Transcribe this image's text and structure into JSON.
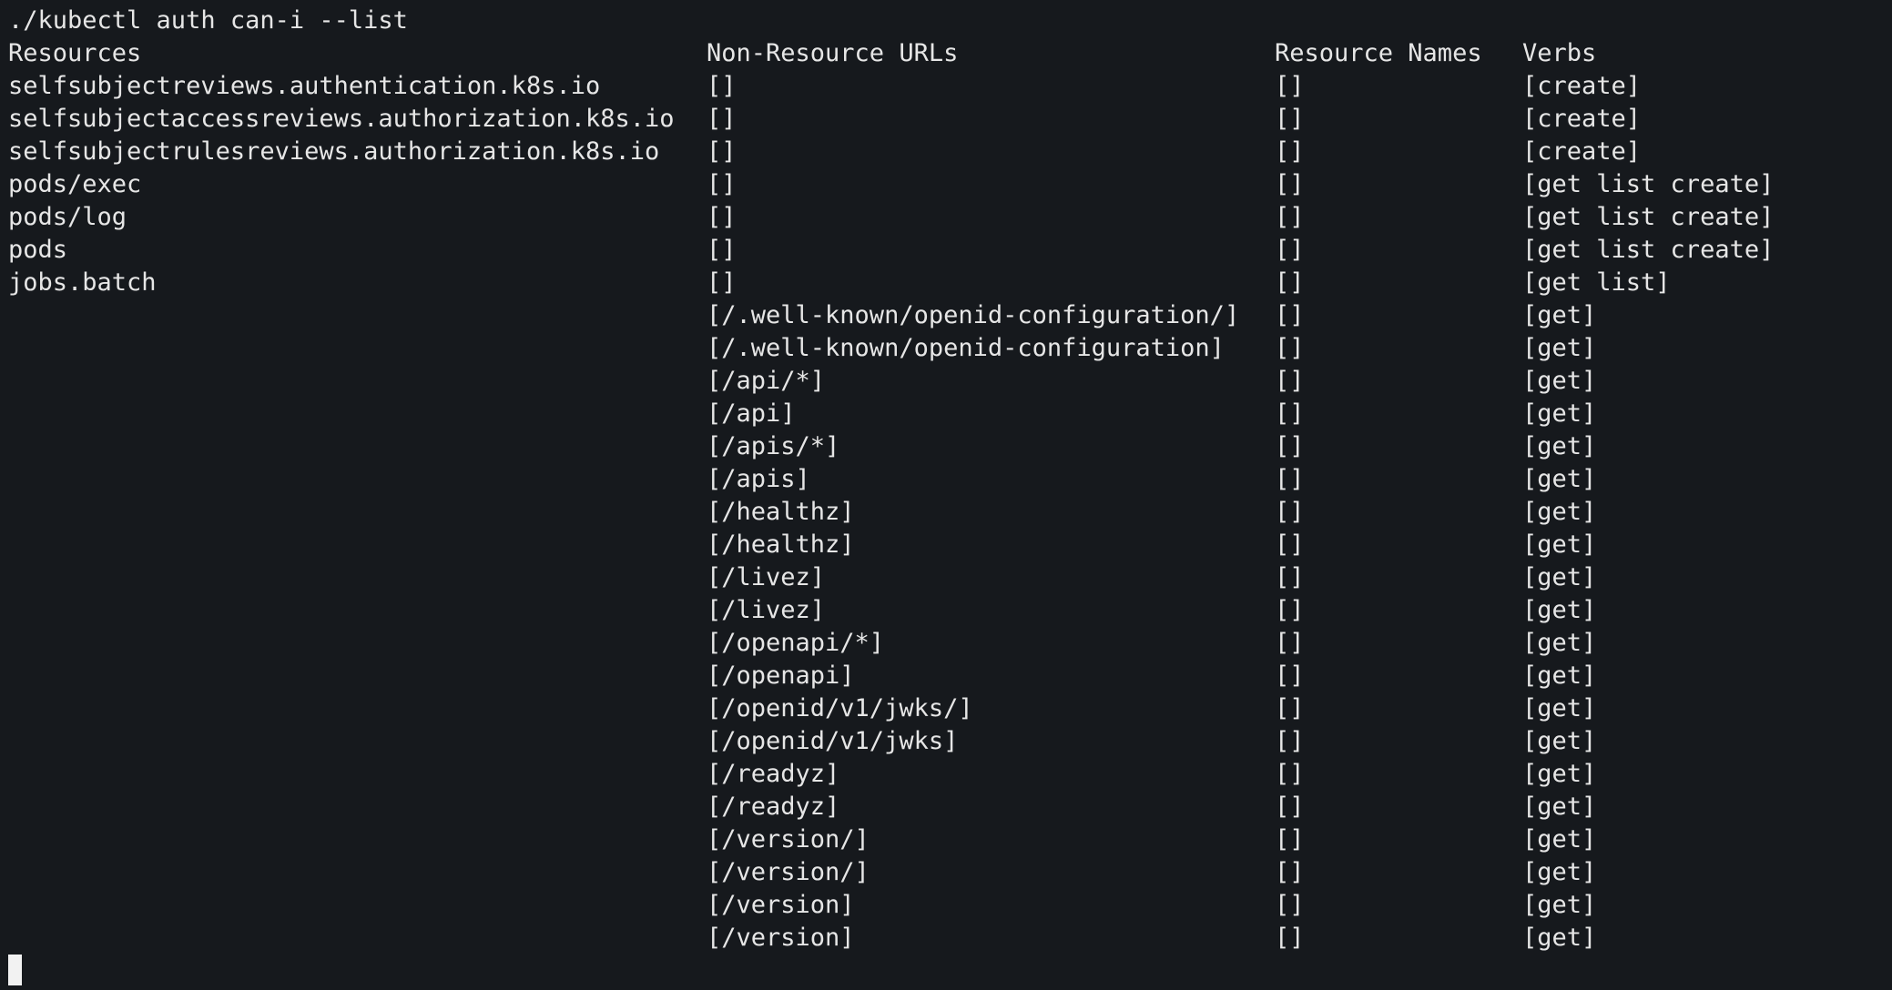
{
  "command": "./kubectl auth can-i --list",
  "headers": {
    "resources": "Resources",
    "non_resource_urls": "Non-Resource URLs",
    "resource_names": "Resource Names",
    "verbs": "Verbs"
  },
  "rows": [
    {
      "resource": "selfsubjectreviews.authentication.k8s.io",
      "url": "[]",
      "names": "[]",
      "verbs": "[create]"
    },
    {
      "resource": "selfsubjectaccessreviews.authorization.k8s.io",
      "url": "[]",
      "names": "[]",
      "verbs": "[create]"
    },
    {
      "resource": "selfsubjectrulesreviews.authorization.k8s.io",
      "url": "[]",
      "names": "[]",
      "verbs": "[create]"
    },
    {
      "resource": "pods/exec",
      "url": "[]",
      "names": "[]",
      "verbs": "[get list create]"
    },
    {
      "resource": "pods/log",
      "url": "[]",
      "names": "[]",
      "verbs": "[get list create]"
    },
    {
      "resource": "pods",
      "url": "[]",
      "names": "[]",
      "verbs": "[get list create]"
    },
    {
      "resource": "jobs.batch",
      "url": "[]",
      "names": "[]",
      "verbs": "[get list]"
    },
    {
      "resource": "",
      "url": "[/.well-known/openid-configuration/]",
      "names": "[]",
      "verbs": "[get]"
    },
    {
      "resource": "",
      "url": "[/.well-known/openid-configuration]",
      "names": "[]",
      "verbs": "[get]"
    },
    {
      "resource": "",
      "url": "[/api/*]",
      "names": "[]",
      "verbs": "[get]"
    },
    {
      "resource": "",
      "url": "[/api]",
      "names": "[]",
      "verbs": "[get]"
    },
    {
      "resource": "",
      "url": "[/apis/*]",
      "names": "[]",
      "verbs": "[get]"
    },
    {
      "resource": "",
      "url": "[/apis]",
      "names": "[]",
      "verbs": "[get]"
    },
    {
      "resource": "",
      "url": "[/healthz]",
      "names": "[]",
      "verbs": "[get]"
    },
    {
      "resource": "",
      "url": "[/healthz]",
      "names": "[]",
      "verbs": "[get]"
    },
    {
      "resource": "",
      "url": "[/livez]",
      "names": "[]",
      "verbs": "[get]"
    },
    {
      "resource": "",
      "url": "[/livez]",
      "names": "[]",
      "verbs": "[get]"
    },
    {
      "resource": "",
      "url": "[/openapi/*]",
      "names": "[]",
      "verbs": "[get]"
    },
    {
      "resource": "",
      "url": "[/openapi]",
      "names": "[]",
      "verbs": "[get]"
    },
    {
      "resource": "",
      "url": "[/openid/v1/jwks/]",
      "names": "[]",
      "verbs": "[get]"
    },
    {
      "resource": "",
      "url": "[/openid/v1/jwks]",
      "names": "[]",
      "verbs": "[get]"
    },
    {
      "resource": "",
      "url": "[/readyz]",
      "names": "[]",
      "verbs": "[get]"
    },
    {
      "resource": "",
      "url": "[/readyz]",
      "names": "[]",
      "verbs": "[get]"
    },
    {
      "resource": "",
      "url": "[/version/]",
      "names": "[]",
      "verbs": "[get]"
    },
    {
      "resource": "",
      "url": "[/version/]",
      "names": "[]",
      "verbs": "[get]"
    },
    {
      "resource": "",
      "url": "[/version]",
      "names": "[]",
      "verbs": "[get]"
    },
    {
      "resource": "",
      "url": "[/version]",
      "names": "[]",
      "verbs": "[get]"
    }
  ],
  "colors": {
    "background": "#16191d",
    "foreground": "#e6e6e6",
    "cursor": "#f2f2f2"
  }
}
